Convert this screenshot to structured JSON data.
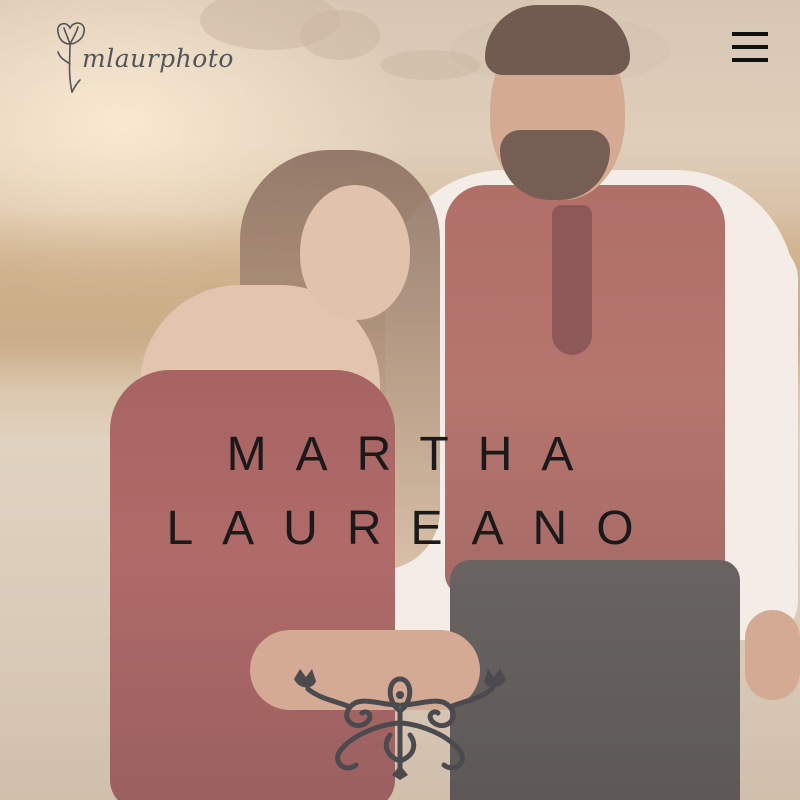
{
  "header": {
    "logo_text": "mlaurphoto",
    "menu_icon": "hamburger-menu-icon"
  },
  "hero": {
    "title_line1": "MARTHA",
    "title_line2": "LAUREANO",
    "ornament_icon": "flourish-ornament-icon"
  },
  "colors": {
    "title_text": "#1a1a1a",
    "logo_text": "#54555a",
    "menu_icon": "#111111",
    "ornament": "#4a4a4f"
  }
}
